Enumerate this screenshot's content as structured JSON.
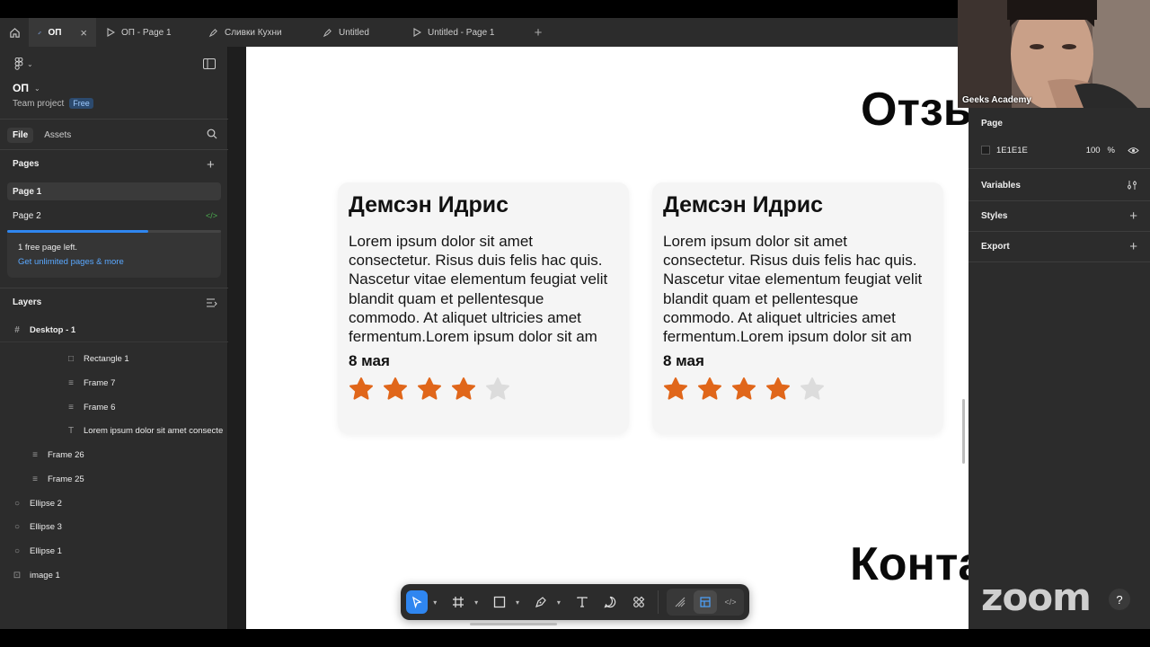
{
  "tabs": [
    {
      "label": "ОП",
      "kind": "design",
      "active": true
    },
    {
      "label": "ОП - Page 1",
      "kind": "prototype"
    },
    {
      "label": "Сливки Кухни",
      "kind": "design"
    },
    {
      "label": "Untitled",
      "kind": "design"
    },
    {
      "label": "Untitled - Page 1",
      "kind": "prototype"
    }
  ],
  "project": {
    "name": "ОП",
    "team": "Team project",
    "plan_badge": "Free"
  },
  "left_tabs": {
    "file": "File",
    "assets": "Assets"
  },
  "pages": {
    "title": "Pages",
    "items": [
      "Page 1",
      "Page 2"
    ],
    "used_fraction": 0.66,
    "upsell_line1": "1 free page left.",
    "upsell_line2": "Get unlimited pages & more"
  },
  "layers": {
    "title": "Layers",
    "items": [
      {
        "label": "Desktop - 1",
        "icon": "frame-icon"
      },
      {
        "label": "Rectangle 1",
        "icon": "rectangle-icon"
      },
      {
        "label": "Frame 7",
        "icon": "auto-layout-icon"
      },
      {
        "label": "Frame 6",
        "icon": "auto-layout-icon"
      },
      {
        "label": "Lorem ipsum dolor sit amet consecte",
        "icon": "text-icon"
      },
      {
        "label": "Frame 26",
        "icon": "auto-layout-icon"
      },
      {
        "label": "Frame 25",
        "icon": "auto-layout-icon"
      },
      {
        "label": "Ellipse 2",
        "icon": "ellipse-icon"
      },
      {
        "label": "Ellipse 3",
        "icon": "ellipse-icon"
      },
      {
        "label": "Ellipse 1",
        "icon": "ellipse-icon"
      },
      {
        "label": "image 1",
        "icon": "image-icon"
      }
    ]
  },
  "canvas": {
    "heading_top": "Отзы",
    "heading_bottom": "Конта",
    "cards": [
      {
        "name": "Демсэн Идрис",
        "text": "Lorem ipsum dolor sit amet consectetur. Risus duis felis hac quis. Nascetur vitae elementum feugiat velit blandit quam et pellentesque commodo. At aliquet ultricies amet fermentum.Lorem ipsum dolor sit am",
        "date": "8 мая",
        "rating": 4,
        "max_rating": 5
      },
      {
        "name": "Демсэн Идрис",
        "text": "Lorem ipsum dolor sit amet consectetur. Risus duis felis hac quis. Nascetur vitae elementum feugiat velit blandit quam et pellentesque commodo. At aliquet ultricies amet fermentum.Lorem ipsum dolor sit am",
        "date": "8 мая",
        "rating": 4,
        "max_rating": 5
      }
    ]
  },
  "right_panel": {
    "page_title": "Page",
    "bg_color_hex": "1E1E1E",
    "bg_opacity": "100",
    "bg_opacity_unit": "%",
    "variables": "Variables",
    "styles": "Styles",
    "export": "Export"
  },
  "webcam": {
    "label": "Geeks Academy"
  },
  "zoom": {
    "logo": "zoom",
    "help": "?"
  },
  "colors": {
    "accent": "#2f86f0",
    "star_filled": "#e0661a",
    "star_empty": "#dcdcdc",
    "panel_bg": "#2c2c2c"
  }
}
